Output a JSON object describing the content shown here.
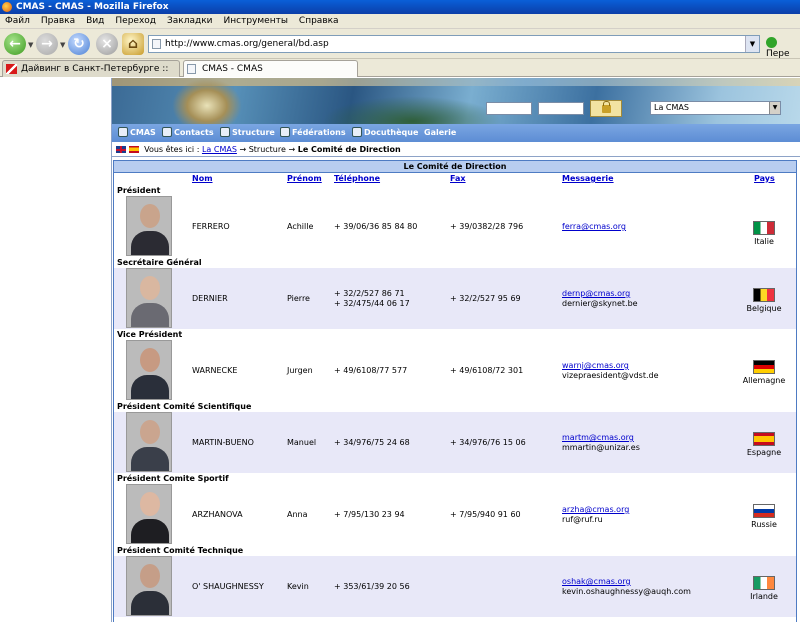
{
  "window": {
    "title": "CMAS - CMAS - Mozilla Firefox"
  },
  "menu": [
    "Файл",
    "Правка",
    "Вид",
    "Переход",
    "Закладки",
    "Инструменты",
    "Справка"
  ],
  "url": "http://www.cmas.org/general/bd.asp",
  "go_label": "Пере",
  "tabs": [
    {
      "label": "Дайвинг в Санкт-Петербурге :: Просмо..."
    },
    {
      "label": "CMAS - CMAS"
    }
  ],
  "banner": {
    "select_value": "La CMAS"
  },
  "sitenav": [
    "CMAS",
    "Contacts",
    "Structure",
    "Fédérations",
    "Docuthèque",
    "Galerie"
  ],
  "breadcrumb": {
    "prefix": "Vous êtes ici :",
    "link": "La CMAS",
    "middle": "→ Structure →",
    "current": "Le Comité de Direction"
  },
  "table": {
    "title": "Le Comité de Direction",
    "headers": {
      "nom": "Nom",
      "prenom": "Prénom",
      "tel": "Téléphone",
      "fax": "Fax",
      "mail": "Messagerie",
      "pays": "Pays"
    },
    "members": [
      {
        "role": "Président",
        "nom": "FERRERO",
        "prenom": "Achille",
        "tel": "+ 39/06/36 85 84 80",
        "tel2": "",
        "fax": "+ 39/0382/28 796",
        "mail": "ferra@cmas.org",
        "mail2": "",
        "pays": "Italie",
        "flag": "italy-flag"
      },
      {
        "role": "Secrétaire Général",
        "nom": "DERNIER",
        "prenom": "Pierre",
        "tel": "+ 32/2/527 86 71",
        "tel2": "+ 32/475/44 06 17",
        "fax": "+ 32/2/527 95 69",
        "mail": "dernp@cmas.org",
        "mail2": "dernier@skynet.be",
        "pays": "Belgique",
        "flag": "belgium-flag"
      },
      {
        "role": "Vice Président",
        "nom": "WARNECKE",
        "prenom": "Jurgen",
        "tel": "+ 49/6108/77 577",
        "tel2": "",
        "fax": "+ 49/6108/72 301",
        "mail": "warnj@cmas.org",
        "mail2": "vizepraesident@vdst.de",
        "pays": "Allemagne",
        "flag": "germany-flag"
      },
      {
        "role": "Président Comité Scientifique",
        "nom": "MARTIN-BUENO",
        "prenom": "Manuel",
        "tel": "+ 34/976/75 24 68",
        "tel2": "",
        "fax": "+ 34/976/76 15 06",
        "mail": "martm@cmas.org",
        "mail2": "mmartin@unizar.es",
        "pays": "Espagne",
        "flag": "spain-flag"
      },
      {
        "role": "Président Comite Sportif",
        "nom": "ARZHANOVA",
        "prenom": "Anna",
        "tel": "+ 7/95/130 23 94",
        "tel2": "",
        "fax": "+ 7/95/940 91 60",
        "mail": "arzha@cmas.org",
        "mail2": "ruf@ruf.ru",
        "pays": "Russie",
        "flag": "russia-flag"
      },
      {
        "role": "Président Comité Technique",
        "nom": "O' SHAUGHNESSY",
        "prenom": "Kevin",
        "tel": "+ 353/61/39 20 56",
        "tel2": "",
        "fax": "",
        "mail": "oshak@cmas.org",
        "mail2": "kevin.oshaughnessy@auqh.com",
        "pays": "Irlande",
        "flag": "ireland-flag"
      }
    ]
  }
}
